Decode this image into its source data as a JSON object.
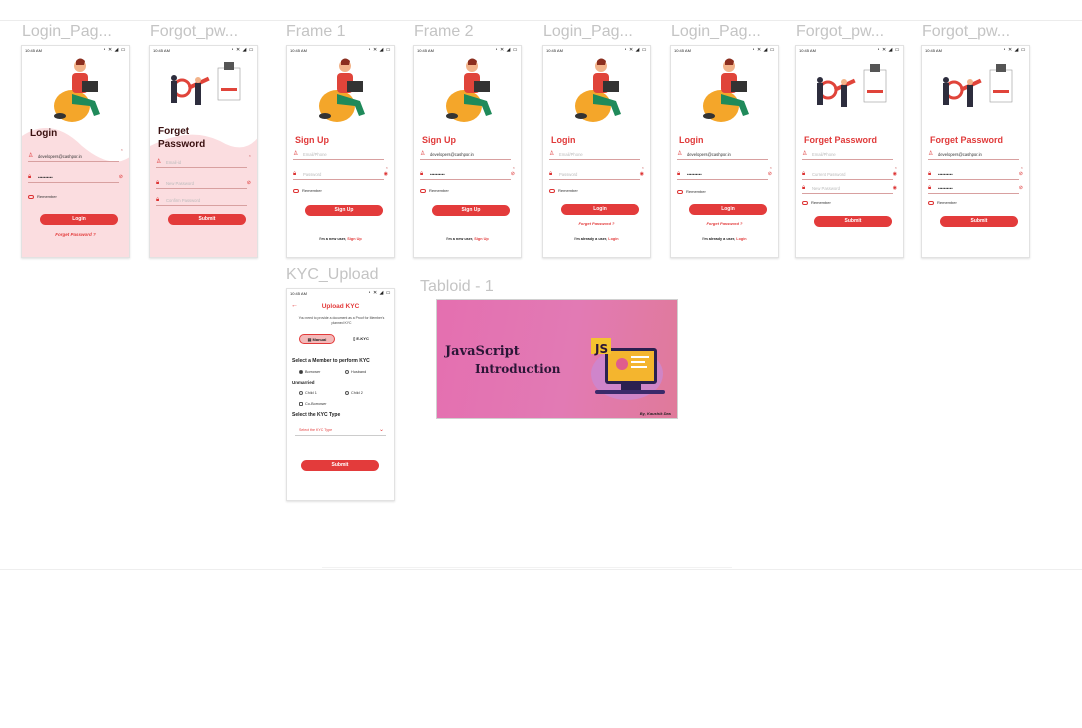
{
  "frames": [
    {
      "label": "Login_Pag...",
      "time": "10:45 AM",
      "title": "Login",
      "email": "developers@cashpor.in",
      "password": "••••••••••",
      "remember": "Remember",
      "button": "Login",
      "link": "Forget Password ?"
    },
    {
      "label": "Forgot_pw...",
      "time": "10:45 AM",
      "title_line1": "Forget",
      "title_line2": "Password",
      "f1": "Email-id",
      "f2": "New Password",
      "f3": "Confirm Password",
      "button": "Submit"
    },
    {
      "label": "Frame 1",
      "time": "10:45 AM",
      "title": "Sign Up",
      "f1": "Email/Phone",
      "f2": "Password",
      "remember": "Remember",
      "button": "Sign Up",
      "foot": "I'm a new user,",
      "foot_link": "Sign Up"
    },
    {
      "label": "Frame 2",
      "time": "10:45 AM",
      "title": "Sign Up",
      "f1": "developers@cashpor.in",
      "f2": "••••••••••",
      "remember": "Remember",
      "button": "Sign Up",
      "foot": "I'm a new user,",
      "foot_link": "Sign Up"
    },
    {
      "label": "Login_Pag...",
      "time": "10:45 AM",
      "title": "Login",
      "f1": "Email/Phone",
      "f2": "Password",
      "remember": "Remember",
      "button": "Login",
      "link": "Forget Password ?",
      "foot": "I'm already a user,",
      "foot_link": "Login"
    },
    {
      "label": "Login_Pag...",
      "time": "10:45 AM",
      "title": "Login",
      "f1": "developers@cashpor.in",
      "f2": "••••••••••",
      "remember": "Remember",
      "button": "Login",
      "link": "Forget Password ?",
      "foot": "I'm already a user,",
      "foot_link": "Login"
    },
    {
      "label": "Forgot_pw...",
      "time": "10:45 AM",
      "title": "Forget Password",
      "f1": "Email/Phone",
      "f2": "Current Password",
      "f3": "New Password",
      "remember": "Remember",
      "button": "Submit"
    },
    {
      "label": "Forgot_pw...",
      "time": "10:45 AM",
      "title": "Forget Password",
      "f1": "developers@cashpor.in",
      "f2": "••••••••••",
      "f3": "••••••••••",
      "remember": "Remember",
      "button": "Submit"
    }
  ],
  "kyc": {
    "label": "KYC_Upload",
    "time": "10:45 AM",
    "title": "Upload KYC",
    "subtitle": "You need to provide a document as a Proof for Member's planned KYC",
    "tab_manual": "Manual",
    "tab_ekyc": "E-KYC",
    "section_member": "Select a Member to perform KYC",
    "opt_borrower": "Borrower",
    "opt_husband": "Husband",
    "section_unmarried": "Unmarried",
    "opt_child1": "Child 1",
    "opt_child2": "Child 2",
    "opt_coborrower": "Co-Borrower",
    "section_type": "Select the KYC Type",
    "select_placeholder": "Select the KYC Type",
    "button": "Submit"
  },
  "tabloid": {
    "label": "Tabloid - 1",
    "line1": "JavaScript",
    "line2": "Introduction",
    "badge": "JS",
    "byline": "By, Kaushik Das"
  },
  "colors": {
    "accent": "#e33b3b",
    "pink_bg": "#fbdde0",
    "tabloid_bg": "#e46fb0"
  }
}
